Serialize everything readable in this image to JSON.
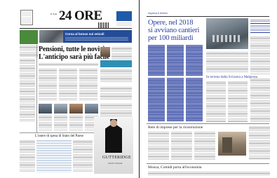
{
  "left": {
    "masthead": {
      "prefix": "Il Sole",
      "number": "24",
      "name": "ORE"
    },
    "headline": {
      "line1": "Pensioni, tutte le novità",
      "line2": "L'anticipo sarà più facile"
    },
    "banner_text": "Corsa al bonus sui veicoli",
    "bottom_heading": "L'onere di spesa di Stato del Paese",
    "ad": {
      "brand": "GUTTERIDGE",
      "sub": "SHOP ONLINE"
    }
  },
  "right": {
    "header_tag": "Impresa & territori",
    "headline": {
      "line1": "Opere, nel 2018",
      "line2": "si avviano cantieri",
      "line3": "per 100 miliardi"
    },
    "mid_heading": "In terreno dalla Svizzera a Malpensa",
    "lower_heading": "Rete di imprese per la ricostruzione",
    "bottom_heading": "Monza, Comidi porta all'economia"
  },
  "colors": {
    "accent_blue": "#2a3f9e",
    "brand_blue": "#1f5aa8",
    "ink": "#111111"
  }
}
